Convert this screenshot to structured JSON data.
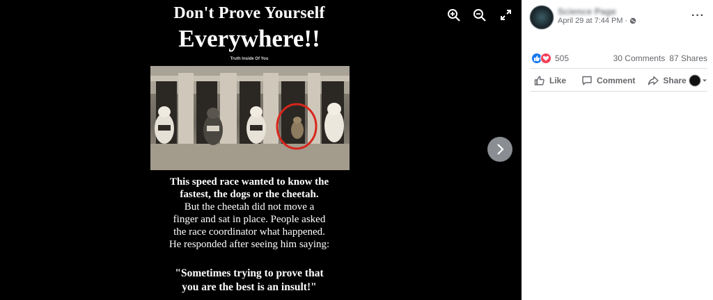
{
  "poster": {
    "title_line1": "Don't Prove Yourself",
    "title_line2": "Everywhere!!",
    "tagline": "Truth Inside Of You",
    "body_line1": "This speed race wanted to know the",
    "body_line2": "fastest, the dogs or the cheetah.",
    "body_line3": "But the cheetah did not move a",
    "body_line4": "finger and sat in place. People asked",
    "body_line5": "the race coordinator what happened.",
    "body_line6": "He responded after seeing him saying:",
    "quote_line1": "\"Sometimes trying to prove that",
    "quote_line2": "you are the best is an insult!\""
  },
  "viewer_controls": {
    "zoom_in_icon": "zoom-in-icon",
    "zoom_out_icon": "zoom-out-icon",
    "fullscreen_icon": "expand-icon",
    "next_icon": "chevron-right-icon"
  },
  "post": {
    "page_name": "Science Page",
    "time": "April 29 at 7:44 PM",
    "audience_icon": "globe-icon",
    "reaction_count": "505",
    "comments": "30 Comments",
    "shares": "87 Shares"
  },
  "actions": {
    "like": "Like",
    "comment": "Comment",
    "share": "Share"
  },
  "colors": {
    "viewer_bg": "#000000",
    "like_blue": "#1877f2",
    "love_red": "#f33e58",
    "secondary_text": "#65676b",
    "highlight_circle": "#d8261c"
  }
}
